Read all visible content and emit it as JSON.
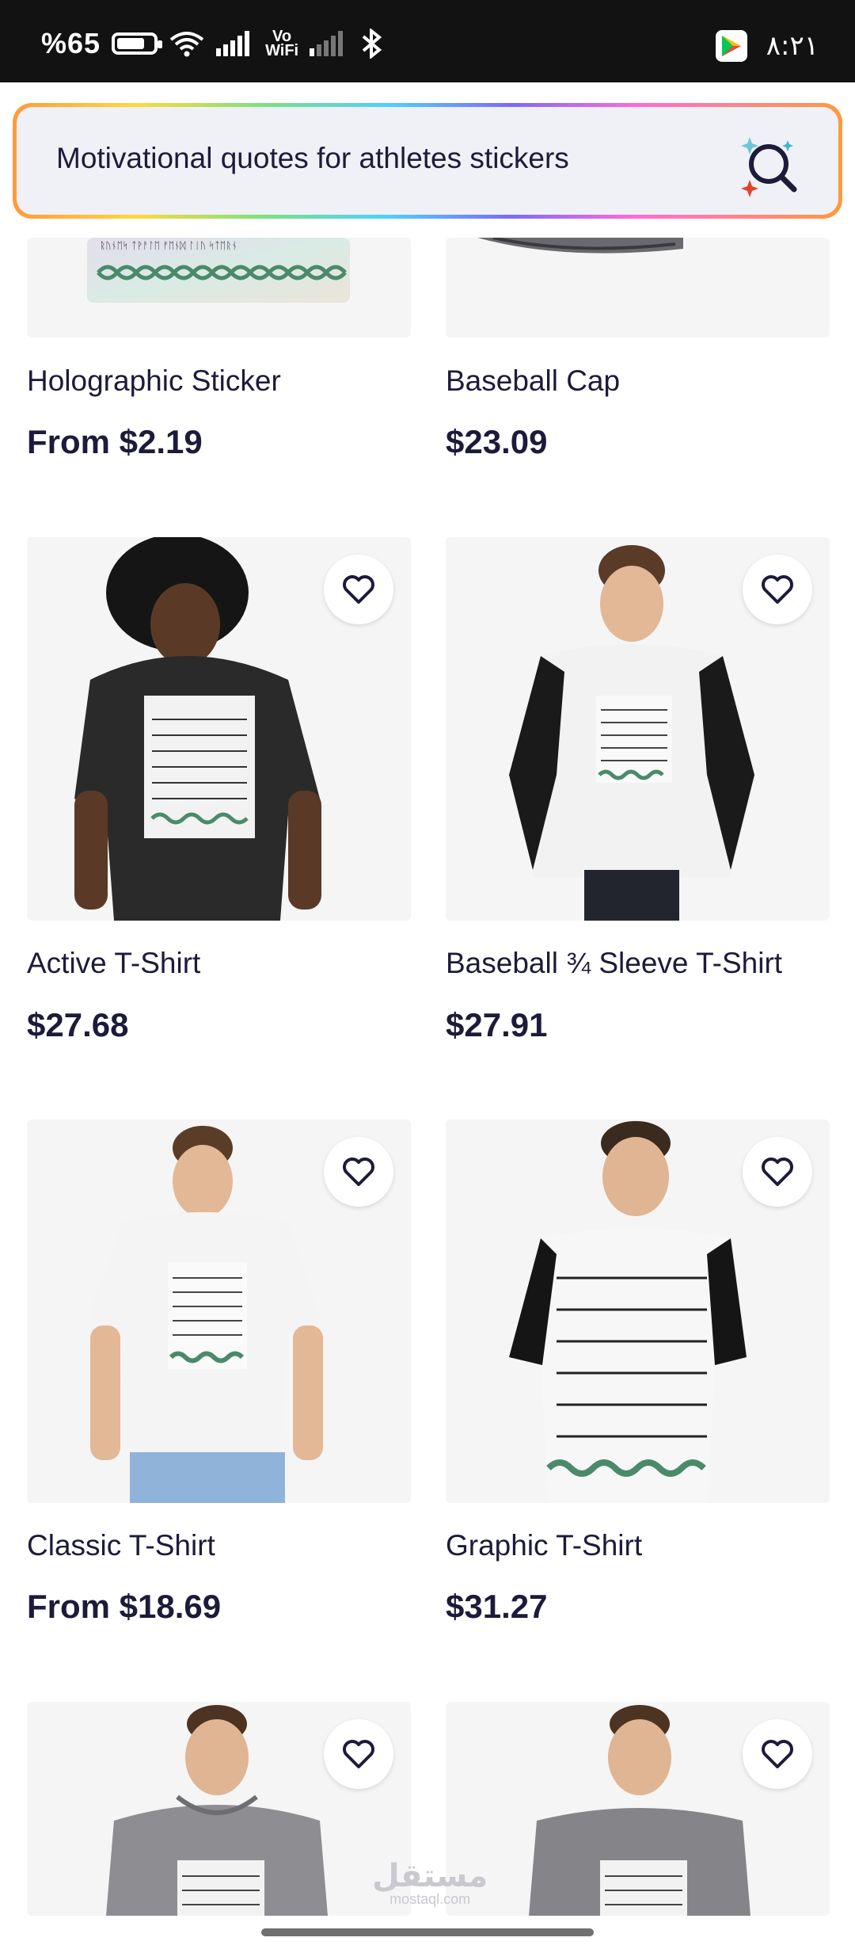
{
  "status_bar": {
    "battery_percent": "%65",
    "clock": "٨:٢١",
    "vowifi_line1": "Vo",
    "vowifi_line2": "WiFi"
  },
  "search": {
    "query": "Motivational quotes for athletes stickers"
  },
  "products": [
    {
      "title": "Holographic Sticker",
      "price": "From $2.19"
    },
    {
      "title": "Baseball Cap",
      "price": "$23.09"
    },
    {
      "title": "Active T-Shirt",
      "price": "$27.68"
    },
    {
      "title": "Baseball ¾ Sleeve T-Shirt",
      "price": "$27.91"
    },
    {
      "title": "Classic T-Shirt",
      "price": "From $18.69"
    },
    {
      "title": "Graphic T-Shirt",
      "price": "$31.27"
    }
  ],
  "watermark": {
    "arabic": "مستقل",
    "latin": "mostaql.com"
  },
  "colors": {
    "text_primary": "#1d1b3a",
    "card_bg": "#f5f5f6",
    "search_bg": "#f0f0f7"
  }
}
